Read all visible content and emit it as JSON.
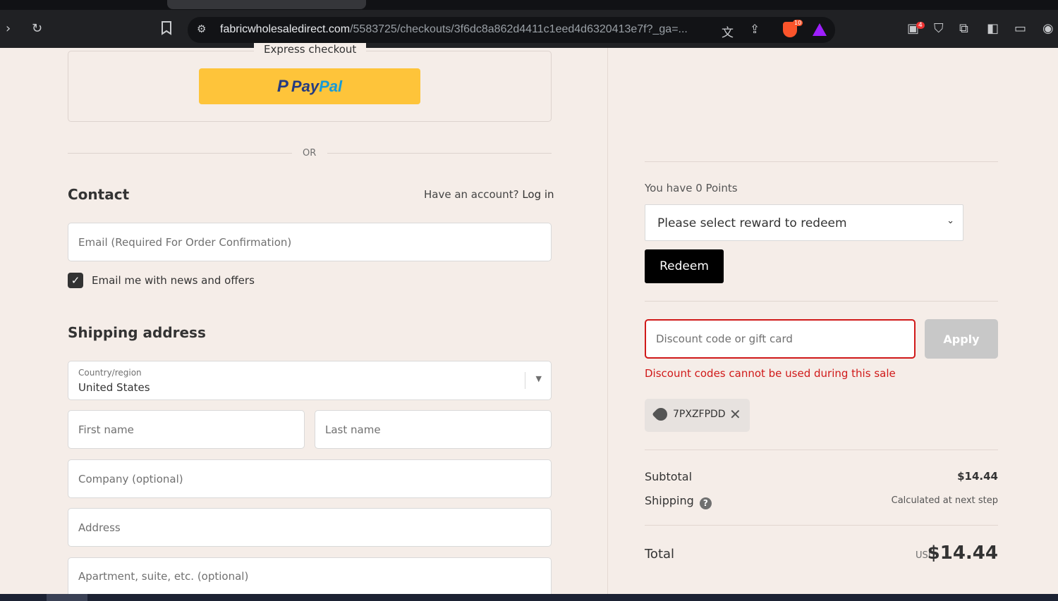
{
  "browser": {
    "url_host": "fabricwholesaledirect.com",
    "url_path": "/5583725/checkouts/3f6dc8a862d4411c1eed4d6320413e7f?_ga=...",
    "brave_shields_count": "10",
    "extension_badge": "4",
    "icons": [
      "forward-icon",
      "reload-icon",
      "bookmark-icon",
      "site-settings-icon",
      "translate-icon",
      "share-icon",
      "brave-shields-icon",
      "brave-rewards-icon",
      "extension-icon",
      "shield-extension-icon",
      "puzzle-icon",
      "sidebar-icon",
      "wallet-icon",
      "profile-icon"
    ]
  },
  "express": {
    "title": "Express checkout",
    "paypal_pay": "Pay",
    "paypal_pal": "Pal",
    "or": "OR"
  },
  "contact": {
    "title": "Contact",
    "account_prompt": "Have an account?",
    "login_link": "Log in",
    "email_placeholder": "Email (Required For Order Confirmation)",
    "newsletter_label": "Email me with news and offers",
    "newsletter_checked": true
  },
  "shipping": {
    "title": "Shipping address",
    "country_label": "Country/region",
    "country_value": "United States",
    "first_name_placeholder": "First name",
    "last_name_placeholder": "Last name",
    "company_placeholder": "Company (optional)",
    "address_placeholder": "Address",
    "apartment_placeholder": "Apartment, suite, etc. (optional)"
  },
  "rewards": {
    "points_text": "You have 0 Points",
    "select_text": "Please select reward to redeem",
    "redeem_label": "Redeem"
  },
  "discount": {
    "placeholder": "Discount code or gift card",
    "apply_label": "Apply",
    "error": "Discount codes cannot be used during this sale",
    "applied_code": "7PXZFPDD"
  },
  "summary": {
    "subtotal_label": "Subtotal",
    "subtotal_value": "$14.44",
    "shipping_label": "Shipping",
    "shipping_value": "Calculated at next step",
    "total_label": "Total",
    "currency": "USD",
    "total_value": "$14.44"
  },
  "colors": {
    "page_bg": "#f5ede8",
    "paypal_yellow": "#fec43a",
    "error_red": "#d01919",
    "redeem_black": "#000000"
  }
}
